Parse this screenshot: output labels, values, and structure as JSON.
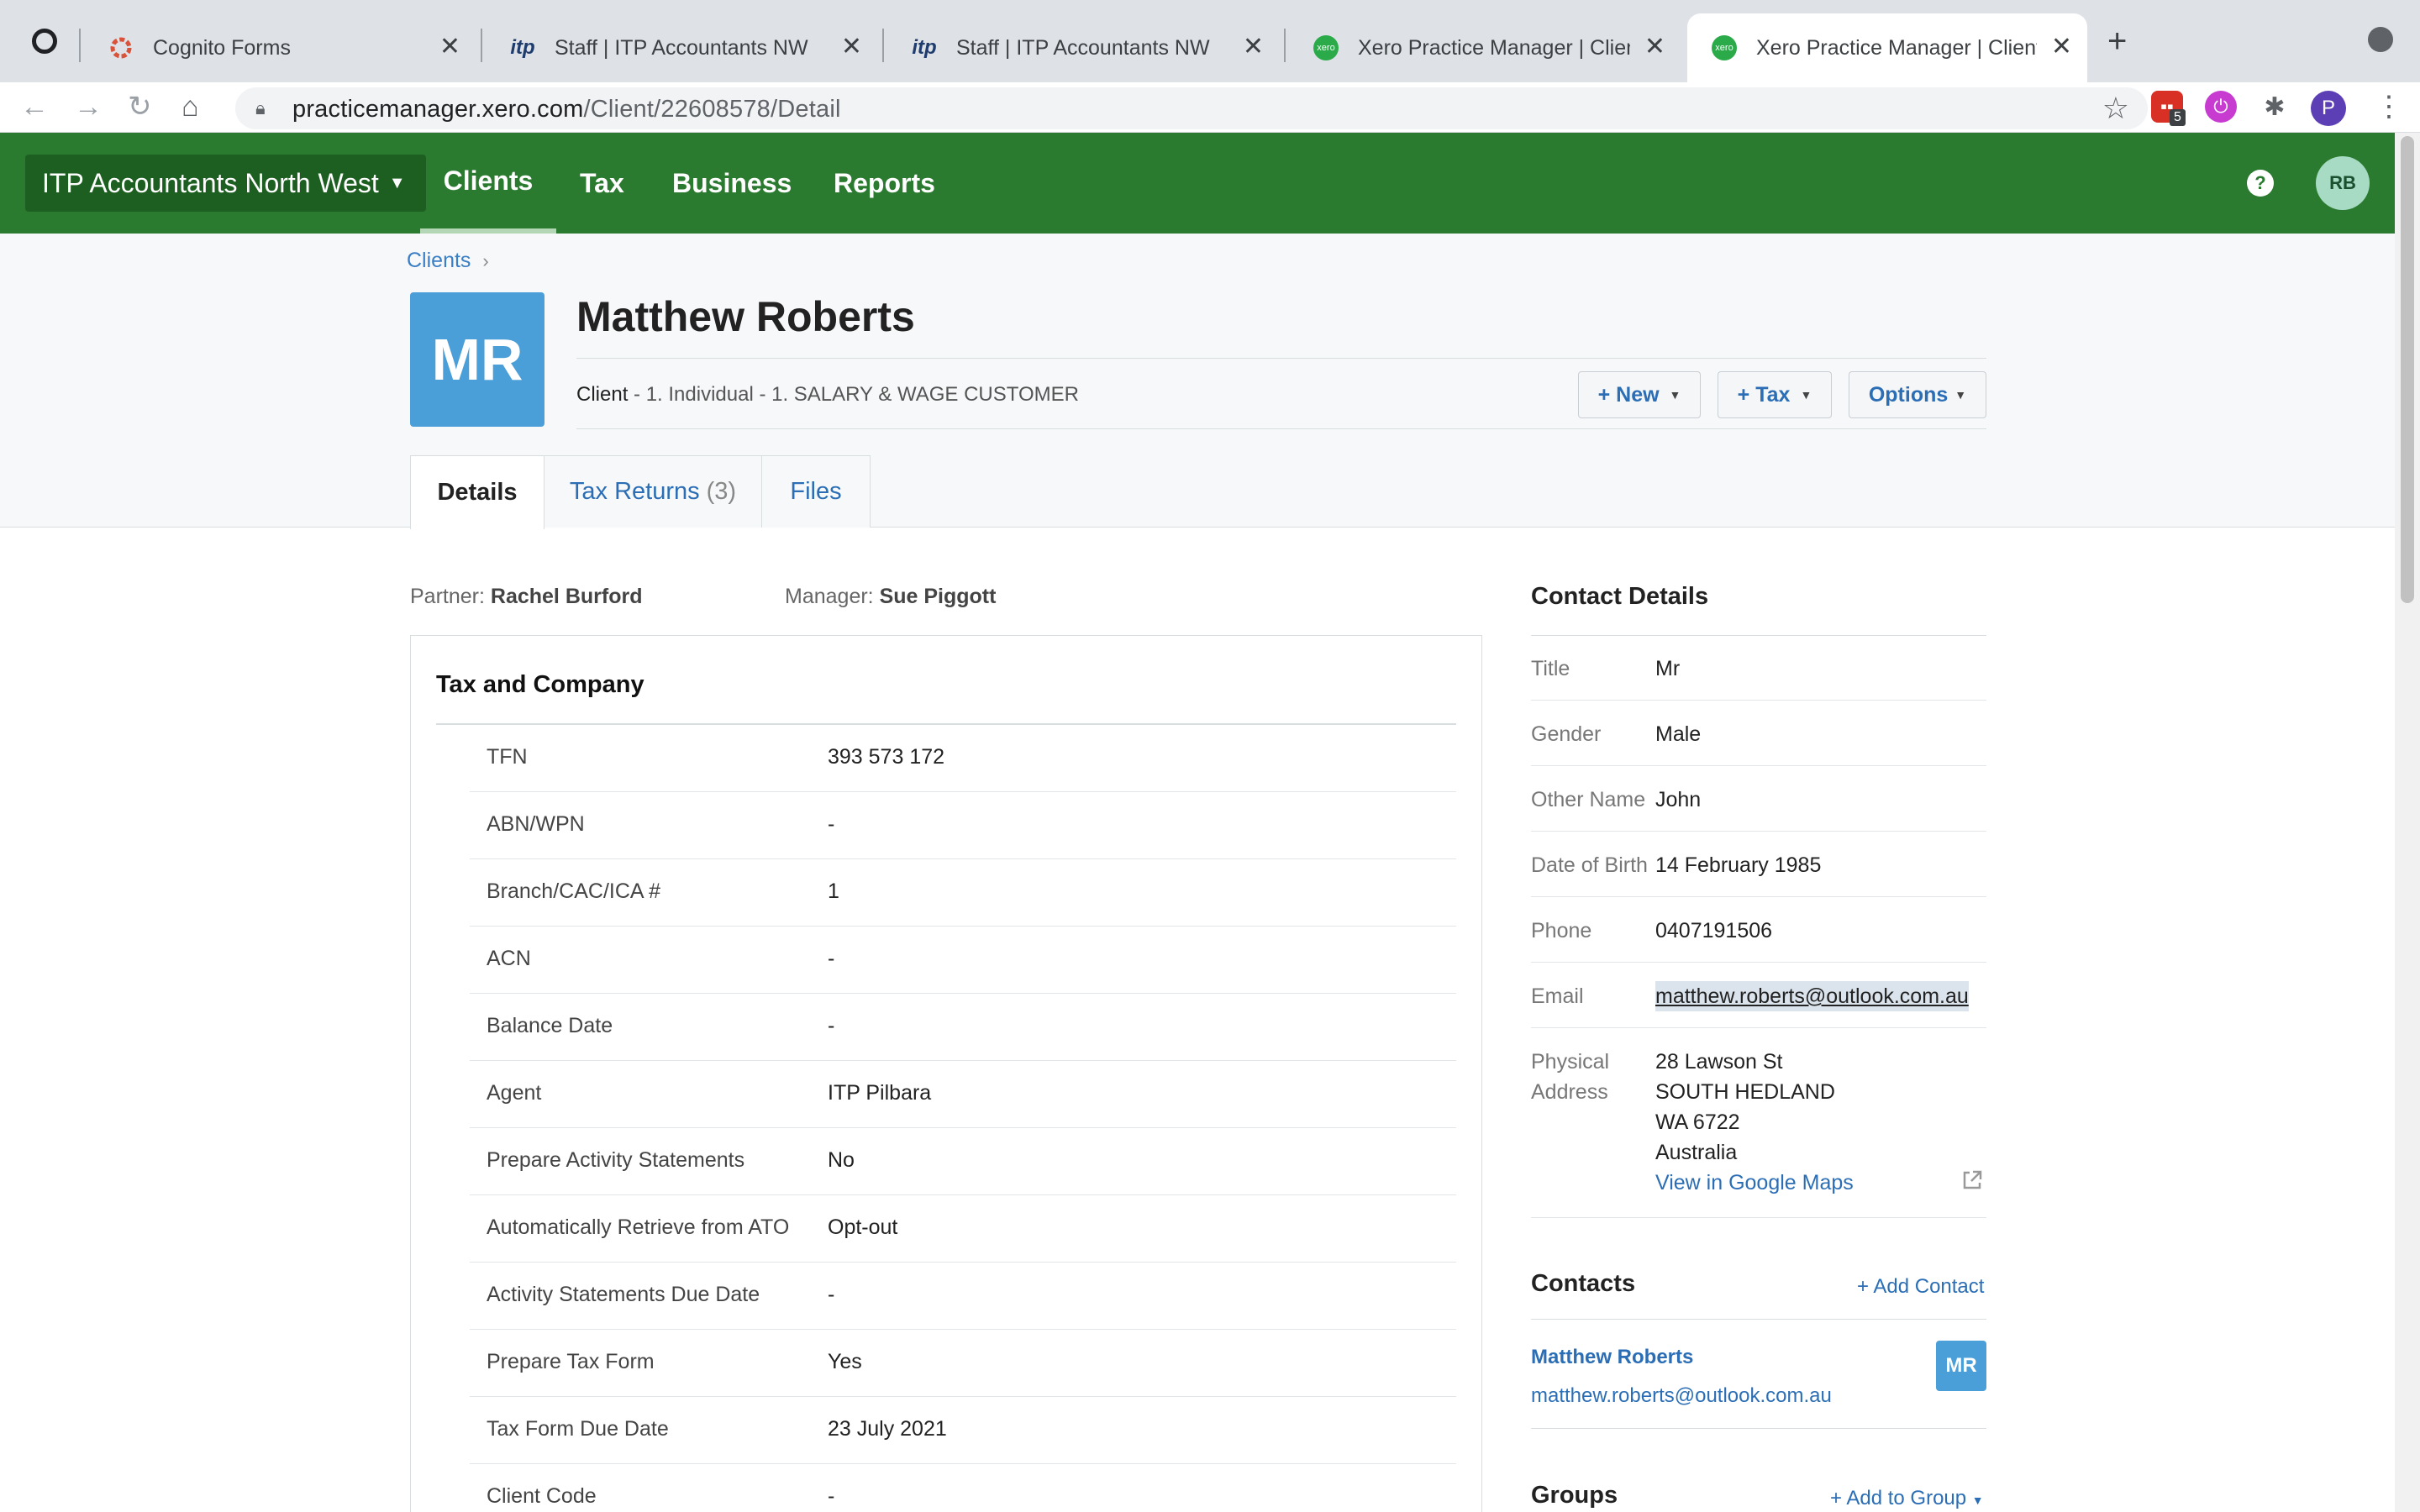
{
  "browser": {
    "tabs": [
      {
        "title": "Cognito Forms",
        "favicon": "cognito-icon"
      },
      {
        "title": "Staff | ITP Accountants NW",
        "favicon": "itp-icon"
      },
      {
        "title": "Staff | ITP Accountants NW",
        "favicon": "itp-icon"
      },
      {
        "title": "Xero Practice Manager | Client",
        "favicon": "xero-icon"
      },
      {
        "title": "Xero Practice Manager | Client",
        "favicon": "xero-icon"
      }
    ],
    "url_domain": "practicemanager.xero.com",
    "url_path": "/Client/22608578/Detail",
    "extension_badge": "5",
    "profile_initial": "P"
  },
  "appnav": {
    "org_name": "ITP Accountants North West",
    "links": [
      "Clients",
      "Tax",
      "Business",
      "Reports"
    ],
    "active_link": "Clients",
    "help": "?",
    "user_initials": "RB",
    "brand_color": "#2a7a2f"
  },
  "header": {
    "breadcrumb": "Clients",
    "avatar_initials": "MR",
    "client_name": "Matthew Roberts",
    "subtitle_type": "Client",
    "subtitle_rest": " - 1. Individual - 1. SALARY & WAGE CUSTOMER",
    "buttons": {
      "new": "+ New",
      "tax": "+ Tax",
      "options": "Options"
    },
    "tabs": {
      "details": "Details",
      "tax_returns": "Tax Returns",
      "tax_returns_count": "(3)",
      "files": "Files"
    }
  },
  "meta": {
    "partner_label": "Partner:",
    "partner": "Rachel Burford",
    "manager_label": "Manager:",
    "manager": "Sue Piggott"
  },
  "tax_company": {
    "title": "Tax and Company",
    "rows": [
      {
        "label": "TFN",
        "value": "393 573 172"
      },
      {
        "label": "ABN/WPN",
        "value": "-"
      },
      {
        "label": "Branch/CAC/ICA #",
        "value": "1"
      },
      {
        "label": "ACN",
        "value": "-"
      },
      {
        "label": "Balance Date",
        "value": "-"
      },
      {
        "label": "Agent",
        "value": "ITP Pilbara"
      },
      {
        "label": "Prepare Activity Statements",
        "value": "No"
      },
      {
        "label": "Automatically Retrieve from ATO",
        "value": "Opt-out"
      },
      {
        "label": "Activity Statements Due Date",
        "value": "-"
      },
      {
        "label": "Prepare Tax Form",
        "value": "Yes"
      },
      {
        "label": "Tax Form Due Date",
        "value": "23 July 2021"
      },
      {
        "label": "Client Code",
        "value": "-"
      }
    ]
  },
  "contact_details": {
    "title": "Contact Details",
    "title_label": "Title",
    "title_value": "Mr",
    "gender_label": "Gender",
    "gender_value": "Male",
    "other_name_label": "Other Name",
    "other_name_value": "John",
    "dob_label": "Date of Birth",
    "dob_value": "14 February 1985",
    "phone_label": "Phone",
    "phone_value": "0407191506",
    "email_label": "Email",
    "email_value": "matthew.roberts@outlook.com.au",
    "address_label_1": "Physical",
    "address_label_2": "Address",
    "address_line1": "28 Lawson St",
    "address_line2": "SOUTH HEDLAND",
    "address_line3": "WA 6722",
    "address_line4": "Australia",
    "maps_link": "View in Google Maps"
  },
  "contacts": {
    "title": "Contacts",
    "add": "+ Add Contact",
    "name": "Matthew Roberts",
    "email": "matthew.roberts@outlook.com.au",
    "initials": "MR"
  },
  "groups": {
    "title": "Groups",
    "add": "+ Add to Group"
  }
}
